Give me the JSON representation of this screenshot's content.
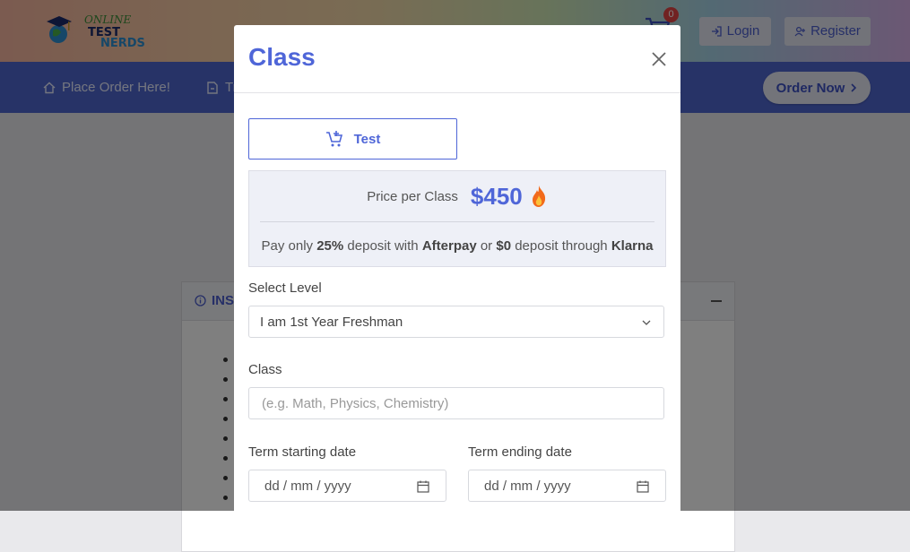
{
  "site": {
    "logo_words": [
      "ONLINE",
      "TEST",
      "NERDS"
    ],
    "cart_count": "0",
    "login_label": "Login",
    "register_label": "Register",
    "nav": {
      "place_order": "Place Order Here!",
      "second_item_partial": "Tr",
      "order_now": "Order Now"
    },
    "panel_title_partial": "INST"
  },
  "modal": {
    "title": "Class",
    "service_tab_label": "Test",
    "price": {
      "label": "Price per Class",
      "value": "$450"
    },
    "deposit": {
      "prefix": "Pay only",
      "percent": "25%",
      "mid1": "deposit with",
      "provider1": "Afterpay",
      "or": "or",
      "zero": "$0",
      "mid2": "deposit through",
      "provider2": "Klarna"
    },
    "select_level": {
      "label": "Select Level",
      "value": "I am 1st Year Freshman"
    },
    "class_field": {
      "label": "Class",
      "placeholder": "(e.g. Math, Physics, Chemistry)"
    },
    "term_start": {
      "label": "Term starting date",
      "placeholder": "dd / mm / yyyy"
    },
    "term_end": {
      "label": "Term ending date",
      "placeholder": "dd / mm / yyyy"
    }
  },
  "colors": {
    "accent": "#4f66d8",
    "navbar": "#4f66cf",
    "badge": "#e24444"
  }
}
